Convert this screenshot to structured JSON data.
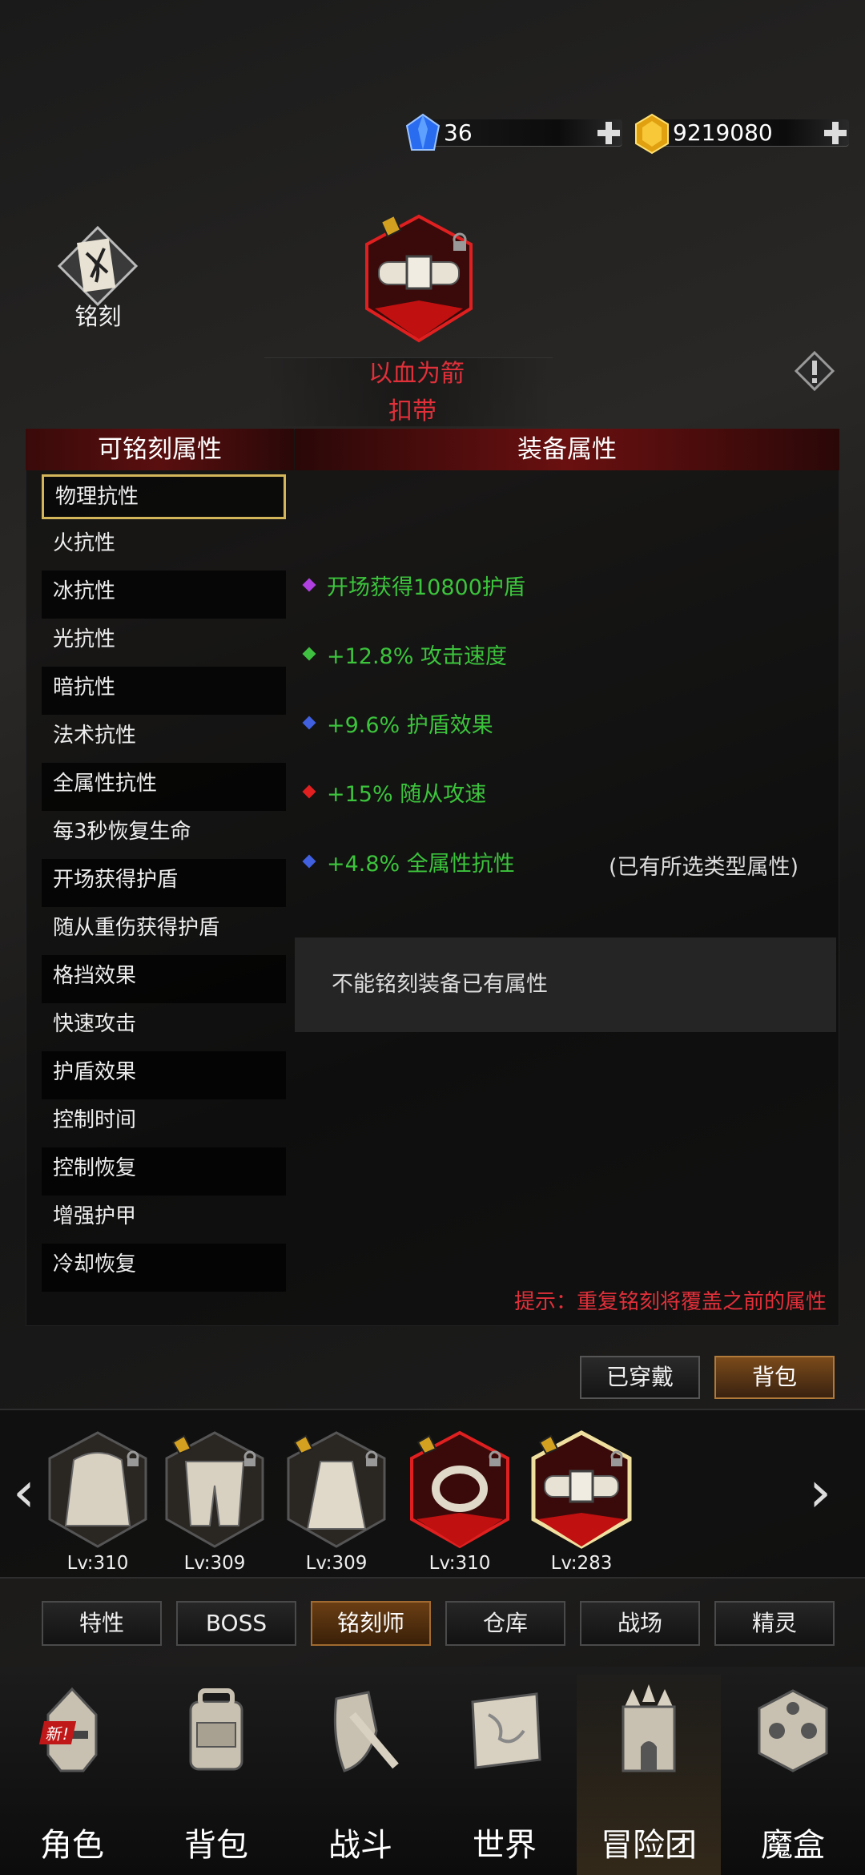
{
  "currency": {
    "gems": "36",
    "gold": "9219080"
  },
  "engrave": {
    "label": "铭刻"
  },
  "item": {
    "name_line1": "以血为箭",
    "name_line2": "扣带"
  },
  "headers": {
    "left": "可铭刻属性",
    "right": "装备属性"
  },
  "engravable_list": [
    "物理抗性",
    "火抗性",
    "冰抗性",
    "光抗性",
    "暗抗性",
    "法术抗性",
    "全属性抗性",
    "每3秒恢复生命",
    "开场获得护盾",
    "随从重伤获得护盾",
    "格挡效果",
    "快速攻击",
    "护盾效果",
    "控制时间",
    "控制恢复",
    "增强护甲",
    "冷却恢复"
  ],
  "equip_attrs": [
    {
      "text": "开场获得10800护盾",
      "color": "#b040e0"
    },
    {
      "text": "+12.8% 攻击速度",
      "color": "#40c040"
    },
    {
      "text": "+9.6% 护盾效果",
      "color": "#4060e0"
    },
    {
      "text": "+15% 随从攻速",
      "color": "#e02020"
    },
    {
      "text": "+4.8% 全属性抗性",
      "color": "#4060e0",
      "note": "(已有所选类型属性)"
    }
  ],
  "notice": "不能铭刻装备已有属性",
  "tip": "提示：重复铭刻将覆盖之前的属性",
  "buttons": {
    "worn": "已穿戴",
    "bag": "背包"
  },
  "equipment": [
    {
      "level": "Lv:310",
      "icon": "cloak-icon"
    },
    {
      "level": "Lv:309",
      "icon": "pants-icon"
    },
    {
      "level": "Lv:309",
      "icon": "robe-icon"
    },
    {
      "level": "Lv:310",
      "icon": "ring-icon"
    },
    {
      "level": "Lv:283",
      "icon": "belt-icon"
    }
  ],
  "tabs": [
    "特性",
    "BOSS",
    "铭刻师",
    "仓库",
    "战场",
    "精灵"
  ],
  "nav": [
    "角色",
    "背包",
    "战斗",
    "世界",
    "冒险团",
    "魔盒"
  ],
  "nav_badge": "新!",
  "colors": {
    "accent": "#e0303a",
    "attr_green": "#3cc43c",
    "selected_border": "#d4b65a"
  }
}
